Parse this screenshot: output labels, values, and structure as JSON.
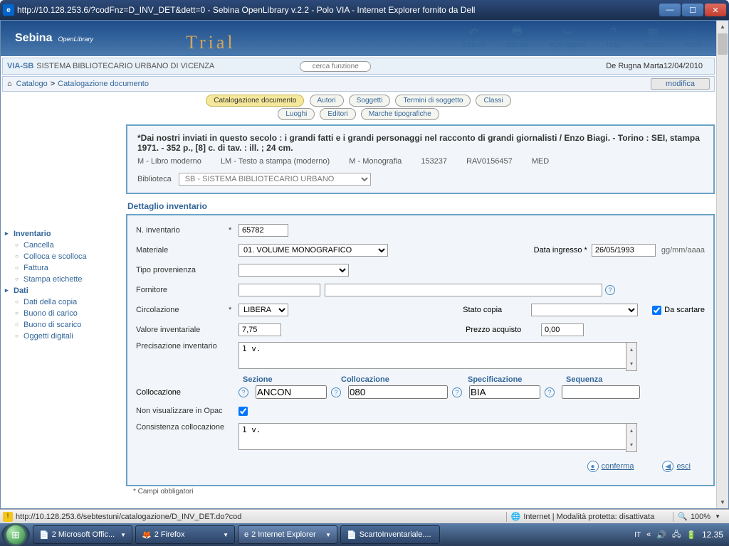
{
  "window": {
    "title": "http://10.128.253.6/?codFnz=D_INV_DET&dett=0 - Sebina OpenLibrary v.2.2 - Polo VIA - Internet Explorer fornito da Dell"
  },
  "app": {
    "brand": "Sebina",
    "brand_sub": "OpenLibrary",
    "trial": "Trial",
    "toolbar": {
      "back": "indietro",
      "print": "stampa",
      "login": "login/logout",
      "help": "help",
      "reports": "reports",
      "home": "home"
    }
  },
  "info_bar": {
    "system_code": "VIA-SB",
    "system_name": "SISTEMA BIBLIOTECARIO URBANO DI VICENZA",
    "search_placeholder": "cerca funzione",
    "username": "De Rugna Marta",
    "date": "12/04/2010"
  },
  "breadcrumb": {
    "home_icon": "⌂",
    "item1": "Catalogo",
    "item2": "Catalogazione documento",
    "modifica": "modifica"
  },
  "tabs": {
    "catalogazione": "Catalogazione documento",
    "autori": "Autori",
    "soggetti": "Soggetti",
    "termini": "Termini di soggetto",
    "classi": "Classi",
    "luoghi": "Luoghi",
    "editori": "Editori",
    "marche": "Marche tipografiche"
  },
  "record": {
    "title": "*Dai nostri inviati in questo secolo : i grandi fatti e i grandi personaggi nel racconto di grandi giornalisti / Enzo Biagi. - Torino : SEI, stampa 1971. - 352 p., [8] c. di tav. : ill. ; 24 cm.",
    "m1": "M - Libro moderno",
    "m2": "LM - Testo a stampa (moderno)",
    "m3": "M - Monografia",
    "m4": "153237",
    "m5": "RAV0156457",
    "m6": "MED",
    "biblioteca_label": "Biblioteca",
    "biblioteca_value": "SB - SISTEMA BIBLIOTECARIO URBANO"
  },
  "sidebar": {
    "inventario": "Inventario",
    "cancella": "Cancella",
    "colloca": "Colloca e scolloca",
    "fattura": "Fattura",
    "stampa_etic": "Stampa etichette",
    "dati": "Dati",
    "dati_copia": "Dati della copia",
    "buono_carico": "Buono di carico",
    "buono_scarico": "Buono di scarico",
    "oggetti": "Oggetti digitali"
  },
  "detail": {
    "heading": "Dettaglio inventario",
    "n_inventario_label": "N. inventario",
    "n_inventario": "65782",
    "materiale_label": "Materiale",
    "materiale": "01. VOLUME MONOGRAFICO",
    "data_ingresso_label": "Data ingresso *",
    "data_ingresso": "26/05/1993",
    "data_hint": "gg/mm/aaaa",
    "tipo_prov_label": "Tipo provenienza",
    "fornitore_label": "Fornitore",
    "circolazione_label": "Circolazione",
    "circolazione": "LIBERA",
    "stato_copia_label": "Stato copia",
    "da_scartare_label": "Da scartare",
    "valore_inv_label": "Valore inventariale",
    "valore_inv": "7,75",
    "prezzo_label": "Prezzo acquisto",
    "prezzo": "0,00",
    "precisazione_label": "Precisazione inventario",
    "precisazione": "1 v.",
    "collocazione_label": "Collocazione",
    "sezione_h": "Sezione",
    "colloc_h": "Collocazione",
    "spec_h": "Specificazione",
    "seq_h": "Sequenza",
    "sezione": "ANCON",
    "colloc_v": "080",
    "spec_v": "BIA",
    "seq_v": "",
    "non_opac_label": "Non visualizzare in Opac",
    "consistenza_label": "Consistenza collocazione",
    "consistenza": "1 v.",
    "conferma": "conferma",
    "esci": "esci",
    "required_note": "* Campi obbligatori"
  },
  "ie_status": {
    "url": "http://10.128.253.6/sebtestuni/catalogazione/D_INV_DET.do?cod",
    "zone": "Internet | Modalità protetta: disattivata",
    "zoom": "100%"
  },
  "taskbar": {
    "t1": "2 Microsoft Offic...",
    "t2": "2 Firefox",
    "t3": "2 Internet Explorer",
    "t4": "ScartoInventariale....",
    "lang": "IT",
    "clock": "12.35"
  }
}
